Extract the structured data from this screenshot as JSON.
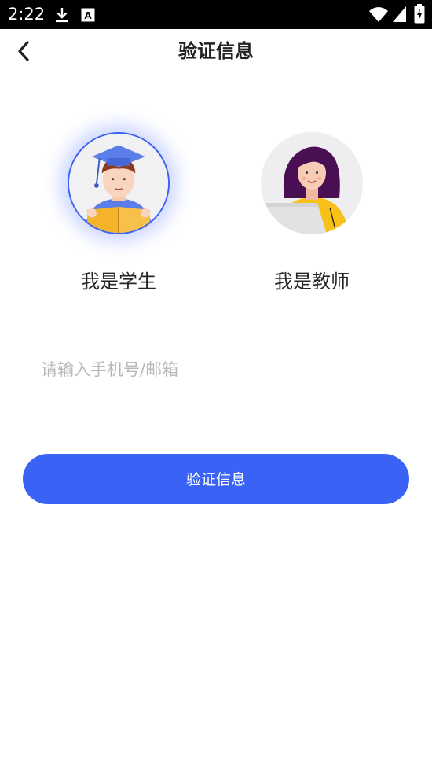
{
  "status_bar": {
    "time": "2:22",
    "icons": [
      "download-icon",
      "font-icon",
      "wifi-icon",
      "signal-icon",
      "battery-icon"
    ]
  },
  "header": {
    "title": "验证信息",
    "back_icon": "chevron-left-icon"
  },
  "roles": [
    {
      "label": "我是学生",
      "selected": true
    },
    {
      "label": "我是教师",
      "selected": false
    }
  ],
  "form": {
    "account_placeholder": "请输入手机号/邮箱",
    "account_value": ""
  },
  "submit": {
    "label": "验证信息"
  },
  "colors": {
    "accent": "#3A63F5",
    "status_bar": "#000000",
    "placeholder": "#B8B8BD"
  }
}
